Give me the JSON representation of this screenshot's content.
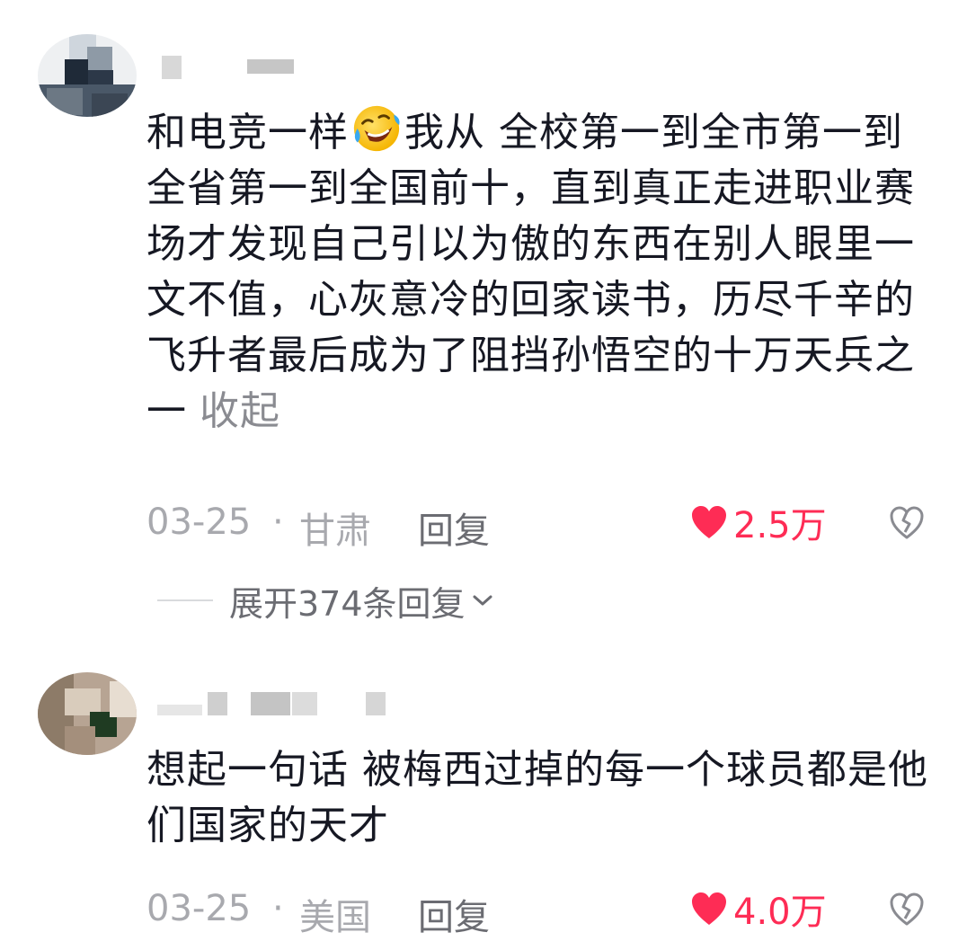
{
  "comments": [
    {
      "content_before_emoji": "和电竞一样",
      "emoji": "grinning-tears-face",
      "content_after_emoji": "我从 全校第一到全市第一到全省第一到全国前十，直到真正走进职业赛场才发现自己引以为傲的东西在别人眼里一文不值，心灰意冷的回家读书，历尽千辛的飞升者最后成为了阻挡孙悟空的十万天兵之一",
      "collapse_label": "收起",
      "date": "03-25",
      "separator": "·",
      "region": "甘肃",
      "reply_label": "回复",
      "likes": "2.5万",
      "expand_label": "展开374条回复"
    },
    {
      "content": "想起一句话 被梅西过掉的每一个球员都是他们国家的天才",
      "date": "03-25",
      "separator": "·",
      "region": "美国",
      "reply_label": "回复",
      "likes": "4.0万"
    }
  ],
  "colors": {
    "like_red": "#fe2c55",
    "meta_gray": "#a8a9ae",
    "text_dark": "#161823"
  },
  "icons": {
    "like": "heart-icon",
    "dislike": "broken-heart-icon",
    "expand": "chevron-down-icon",
    "emoji": "grinning-tears-emoji-icon"
  }
}
